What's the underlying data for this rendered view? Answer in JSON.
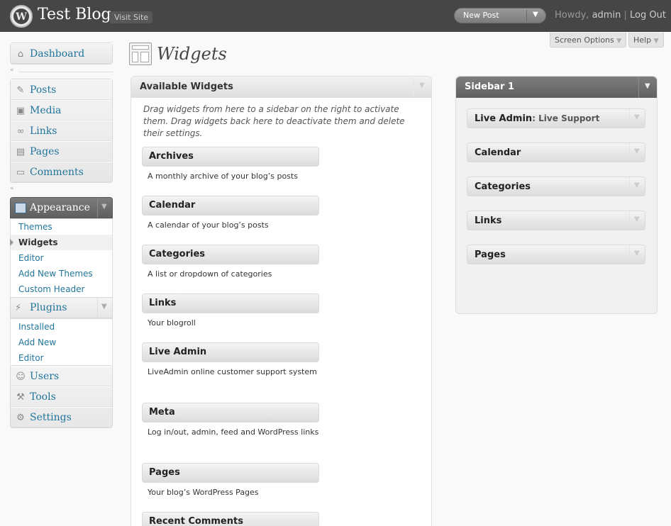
{
  "header": {
    "site_title": "Test Blog",
    "visit_site": "Visit Site",
    "new_post": "New Post",
    "howdy": "Howdy,",
    "user": "admin",
    "separator": "|",
    "logout": "Log Out"
  },
  "screen_options": "Screen Options",
  "help": "Help",
  "menu": {
    "dashboard": "Dashboard",
    "group1": [
      {
        "label": "Posts",
        "icon": "pin-icon"
      },
      {
        "label": "Media",
        "icon": "media-icon"
      },
      {
        "label": "Links",
        "icon": "link-icon"
      },
      {
        "label": "Pages",
        "icon": "page-icon"
      },
      {
        "label": "Comments",
        "icon": "comment-icon"
      }
    ],
    "appearance": {
      "label": "Appearance",
      "items": [
        "Themes",
        "Widgets",
        "Editor",
        "Add New Themes",
        "Custom Header"
      ],
      "current": "Widgets"
    },
    "plugins": {
      "label": "Plugins",
      "items": [
        "Installed",
        "Add New",
        "Editor"
      ]
    },
    "group3": [
      {
        "label": "Users",
        "icon": "users-icon"
      },
      {
        "label": "Tools",
        "icon": "tools-icon"
      },
      {
        "label": "Settings",
        "icon": "settings-icon"
      }
    ]
  },
  "page_title": "Widgets",
  "available": {
    "title": "Available Widgets",
    "description": "Drag widgets from here to a sidebar on the right to activate them. Drag widgets back here to deactivate them and delete their settings.",
    "widgets": [
      {
        "name": "Archives",
        "desc": "A monthly archive of your blog’s posts"
      },
      {
        "name": "Calendar",
        "desc": "A calendar of your blog’s posts"
      },
      {
        "name": "Categories",
        "desc": "A list or dropdown of categories"
      },
      {
        "name": "Links",
        "desc": "Your blogroll"
      },
      {
        "name": "Live Admin",
        "desc": "LiveAdmin online customer support system"
      },
      {
        "name": "Meta",
        "desc": "Log in/out, admin, feed and WordPress links"
      },
      {
        "name": "Pages",
        "desc": "Your blog’s WordPress Pages"
      },
      {
        "name": "Recent Comments",
        "desc": ""
      }
    ]
  },
  "sidebar1": {
    "title": "Sidebar 1",
    "widgets": [
      {
        "name": "Live Admin",
        "instance": ": Live Support"
      },
      {
        "name": "Calendar",
        "instance": ""
      },
      {
        "name": "Categories",
        "instance": ""
      },
      {
        "name": "Links",
        "instance": ""
      },
      {
        "name": "Pages",
        "instance": ""
      }
    ]
  }
}
